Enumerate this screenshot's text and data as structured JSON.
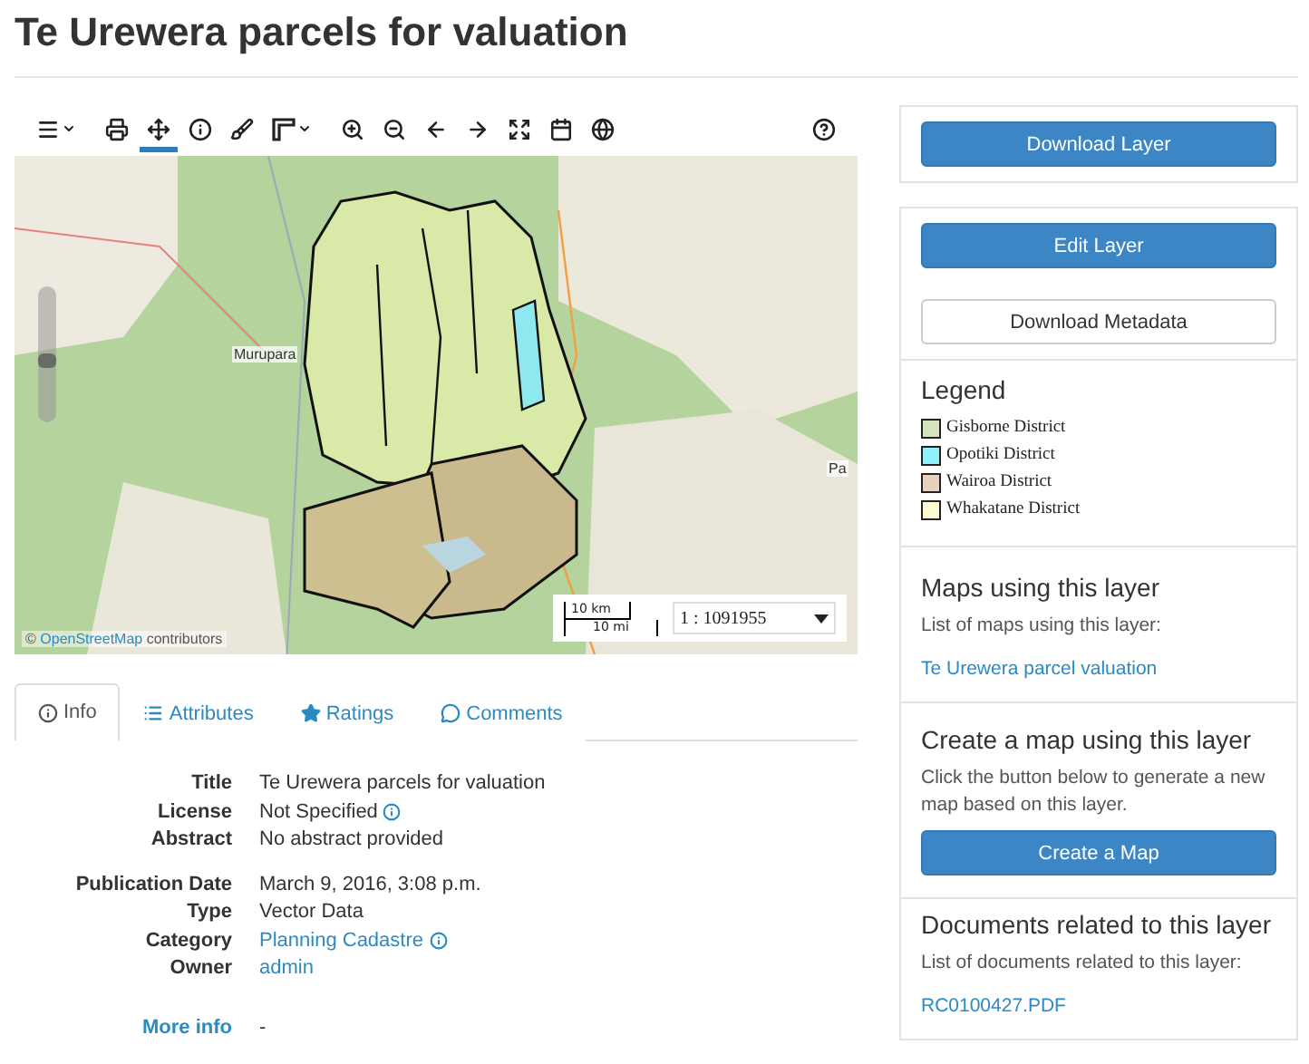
{
  "page": {
    "title": "Te Urewera parcels for valuation"
  },
  "toolbar": {
    "tools": [
      {
        "kind": "menu",
        "selected": false,
        "caret": true
      },
      {
        "kind": "print",
        "selected": false,
        "caret": false
      },
      {
        "kind": "pan",
        "selected": true,
        "caret": false
      },
      {
        "kind": "info",
        "selected": false,
        "caret": false
      },
      {
        "kind": "style",
        "selected": false,
        "caret": false
      },
      {
        "kind": "measure",
        "selected": false,
        "caret": true
      },
      {
        "kind": "zoom-in",
        "selected": false,
        "caret": false
      },
      {
        "kind": "zoom-out",
        "selected": false,
        "caret": false
      },
      {
        "kind": "back",
        "selected": false,
        "caret": false
      },
      {
        "kind": "forward",
        "selected": false,
        "caret": false
      },
      {
        "kind": "extent",
        "selected": false,
        "caret": false
      },
      {
        "kind": "calendar",
        "selected": false,
        "caret": false
      },
      {
        "kind": "globe",
        "selected": false,
        "caret": false
      }
    ]
  },
  "map": {
    "zoom": {
      "level": 0.45
    },
    "places": [
      "Murupara",
      "Pa"
    ],
    "attribution_prefix": "©",
    "attribution_link": "OpenStreetMap",
    "attribution_suffix": "contributors",
    "scale_km": "10 km",
    "scale_mi": "10 mi",
    "scale_ratio": "1 : 1091955"
  },
  "tabs": [
    {
      "label": "Info",
      "selected": true
    },
    {
      "label": "Attributes",
      "selected": false
    },
    {
      "label": "Ratings",
      "selected": false
    },
    {
      "label": "Comments",
      "selected": false
    }
  ],
  "info_groups": [
    {
      "rows": [
        {
          "label": "Title",
          "value": "Te Urewera parcels for valuation",
          "kind": "text",
          "info_icon": false
        },
        {
          "label": "License",
          "value": "Not Specified",
          "kind": "text",
          "info_icon": true
        },
        {
          "label": "Abstract",
          "value": "No abstract provided",
          "kind": "text",
          "info_icon": false
        }
      ]
    },
    {
      "rows": [
        {
          "label": "Publication Date",
          "value": "March 9, 2016, 3:08 p.m.",
          "kind": "text",
          "info_icon": false
        },
        {
          "label": "Type",
          "value": "Vector Data",
          "kind": "text",
          "info_icon": false
        },
        {
          "label": "Category",
          "value": "Planning Cadastre",
          "kind": "link",
          "info_icon": true
        },
        {
          "label": "Owner",
          "value": "admin",
          "kind": "link",
          "info_icon": false
        }
      ]
    }
  ],
  "more_info": {
    "label": "More info",
    "value": "-"
  },
  "sidebar": {
    "download_layer": "Download Layer",
    "edit_layer": "Edit Layer",
    "download_metadata": "Download Metadata",
    "legend": {
      "title": "Legend",
      "items": [
        {
          "label": "Gisborne District",
          "color": "#d6e3bf"
        },
        {
          "label": "Opotiki District",
          "color": "#8ff0f8"
        },
        {
          "label": "Wairoa District",
          "color": "#e6d2bd"
        },
        {
          "label": "Whakatane District",
          "color": "#fdfbd1"
        }
      ]
    },
    "maps": {
      "title": "Maps using this layer",
      "text": "List of maps using this layer:",
      "links": [
        "Te Urewera parcel valuation"
      ]
    },
    "create": {
      "title": "Create a map using this layer",
      "text": "Click the button below to generate a new map based on this layer.",
      "button": "Create a Map"
    },
    "documents": {
      "title": "Documents related to this layer",
      "text": "List of documents related to this layer:",
      "links": [
        "RC0100427.PDF"
      ]
    }
  }
}
